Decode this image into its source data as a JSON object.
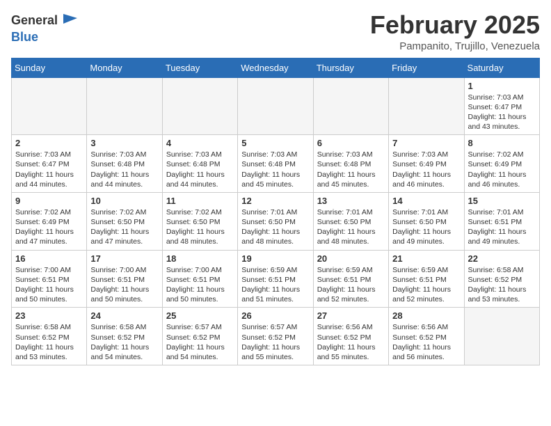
{
  "header": {
    "logo_general": "General",
    "logo_blue": "Blue",
    "month_title": "February 2025",
    "location": "Pampanito, Trujillo, Venezuela"
  },
  "weekdays": [
    "Sunday",
    "Monday",
    "Tuesday",
    "Wednesday",
    "Thursday",
    "Friday",
    "Saturday"
  ],
  "weeks": [
    [
      {
        "day": "",
        "info": ""
      },
      {
        "day": "",
        "info": ""
      },
      {
        "day": "",
        "info": ""
      },
      {
        "day": "",
        "info": ""
      },
      {
        "day": "",
        "info": ""
      },
      {
        "day": "",
        "info": ""
      },
      {
        "day": "1",
        "info": "Sunrise: 7:03 AM\nSunset: 6:47 PM\nDaylight: 11 hours and 43 minutes."
      }
    ],
    [
      {
        "day": "2",
        "info": "Sunrise: 7:03 AM\nSunset: 6:47 PM\nDaylight: 11 hours and 44 minutes."
      },
      {
        "day": "3",
        "info": "Sunrise: 7:03 AM\nSunset: 6:48 PM\nDaylight: 11 hours and 44 minutes."
      },
      {
        "day": "4",
        "info": "Sunrise: 7:03 AM\nSunset: 6:48 PM\nDaylight: 11 hours and 44 minutes."
      },
      {
        "day": "5",
        "info": "Sunrise: 7:03 AM\nSunset: 6:48 PM\nDaylight: 11 hours and 45 minutes."
      },
      {
        "day": "6",
        "info": "Sunrise: 7:03 AM\nSunset: 6:48 PM\nDaylight: 11 hours and 45 minutes."
      },
      {
        "day": "7",
        "info": "Sunrise: 7:03 AM\nSunset: 6:49 PM\nDaylight: 11 hours and 46 minutes."
      },
      {
        "day": "8",
        "info": "Sunrise: 7:02 AM\nSunset: 6:49 PM\nDaylight: 11 hours and 46 minutes."
      }
    ],
    [
      {
        "day": "9",
        "info": "Sunrise: 7:02 AM\nSunset: 6:49 PM\nDaylight: 11 hours and 47 minutes."
      },
      {
        "day": "10",
        "info": "Sunrise: 7:02 AM\nSunset: 6:50 PM\nDaylight: 11 hours and 47 minutes."
      },
      {
        "day": "11",
        "info": "Sunrise: 7:02 AM\nSunset: 6:50 PM\nDaylight: 11 hours and 48 minutes."
      },
      {
        "day": "12",
        "info": "Sunrise: 7:01 AM\nSunset: 6:50 PM\nDaylight: 11 hours and 48 minutes."
      },
      {
        "day": "13",
        "info": "Sunrise: 7:01 AM\nSunset: 6:50 PM\nDaylight: 11 hours and 48 minutes."
      },
      {
        "day": "14",
        "info": "Sunrise: 7:01 AM\nSunset: 6:50 PM\nDaylight: 11 hours and 49 minutes."
      },
      {
        "day": "15",
        "info": "Sunrise: 7:01 AM\nSunset: 6:51 PM\nDaylight: 11 hours and 49 minutes."
      }
    ],
    [
      {
        "day": "16",
        "info": "Sunrise: 7:00 AM\nSunset: 6:51 PM\nDaylight: 11 hours and 50 minutes."
      },
      {
        "day": "17",
        "info": "Sunrise: 7:00 AM\nSunset: 6:51 PM\nDaylight: 11 hours and 50 minutes."
      },
      {
        "day": "18",
        "info": "Sunrise: 7:00 AM\nSunset: 6:51 PM\nDaylight: 11 hours and 50 minutes."
      },
      {
        "day": "19",
        "info": "Sunrise: 6:59 AM\nSunset: 6:51 PM\nDaylight: 11 hours and 51 minutes."
      },
      {
        "day": "20",
        "info": "Sunrise: 6:59 AM\nSunset: 6:51 PM\nDaylight: 11 hours and 52 minutes."
      },
      {
        "day": "21",
        "info": "Sunrise: 6:59 AM\nSunset: 6:51 PM\nDaylight: 11 hours and 52 minutes."
      },
      {
        "day": "22",
        "info": "Sunrise: 6:58 AM\nSunset: 6:52 PM\nDaylight: 11 hours and 53 minutes."
      }
    ],
    [
      {
        "day": "23",
        "info": "Sunrise: 6:58 AM\nSunset: 6:52 PM\nDaylight: 11 hours and 53 minutes."
      },
      {
        "day": "24",
        "info": "Sunrise: 6:58 AM\nSunset: 6:52 PM\nDaylight: 11 hours and 54 minutes."
      },
      {
        "day": "25",
        "info": "Sunrise: 6:57 AM\nSunset: 6:52 PM\nDaylight: 11 hours and 54 minutes."
      },
      {
        "day": "26",
        "info": "Sunrise: 6:57 AM\nSunset: 6:52 PM\nDaylight: 11 hours and 55 minutes."
      },
      {
        "day": "27",
        "info": "Sunrise: 6:56 AM\nSunset: 6:52 PM\nDaylight: 11 hours and 55 minutes."
      },
      {
        "day": "28",
        "info": "Sunrise: 6:56 AM\nSunset: 6:52 PM\nDaylight: 11 hours and 56 minutes."
      },
      {
        "day": "",
        "info": ""
      }
    ]
  ]
}
